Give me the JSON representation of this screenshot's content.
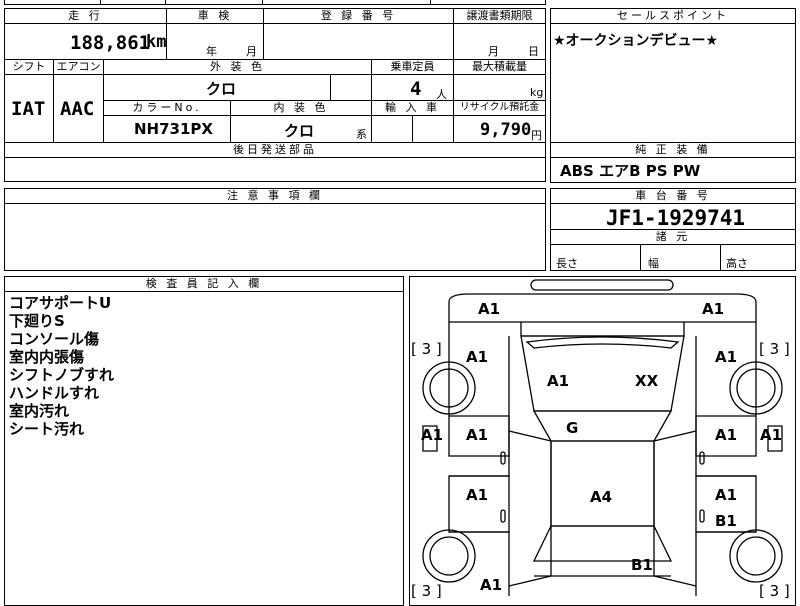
{
  "top_partial_text": "",
  "mileage": {
    "header": "走 行",
    "value": "188,861",
    "unit": "km"
  },
  "inspection": {
    "header": "車 検",
    "year_unit": "年",
    "month_unit": "月"
  },
  "registration": {
    "header": "登 録 番 号"
  },
  "transfer_deadline": {
    "header": "譲渡書類期限",
    "month_unit": "月",
    "day_unit": "日"
  },
  "sales_point": {
    "header": "セールスポイント",
    "text": "★オークションデビュー★"
  },
  "shift": {
    "header": "シフト",
    "value": "IAT"
  },
  "aircon": {
    "header": "エアコン",
    "value": "AAC"
  },
  "exterior_color": {
    "header": "外 装 色",
    "value": "クロ"
  },
  "capacity": {
    "header": "乗車定員",
    "value": "4",
    "unit": "人"
  },
  "max_load": {
    "header": "最大積載量",
    "unit": "kg"
  },
  "color_no": {
    "header": "カラーNo.",
    "value": "NH731PX"
  },
  "interior_color": {
    "header": "内 装 色",
    "value": "クロ",
    "suffix": "系"
  },
  "import_car": {
    "header": "輸 入 車"
  },
  "recycle": {
    "header": "リサイクル預託金",
    "value": "9,790",
    "unit": "円"
  },
  "later_parts": {
    "header": "後日発送部品"
  },
  "equipment": {
    "header": "純 正 装 備",
    "value": "ABS エアB PS PW"
  },
  "caution": {
    "header": "注 意 事 項 欄"
  },
  "chassis": {
    "header": "車 台 番 号",
    "value": "JF1-1929741"
  },
  "dimensions": {
    "header": "諸 元",
    "length": "長さ",
    "width": "幅",
    "height": "高さ"
  },
  "inspector": {
    "header": "検 査 員 記 入 欄",
    "notes": [
      "コアサポートU",
      "下廻りS",
      "コンソール傷",
      "室内内張傷",
      "シフトノブすれ",
      "ハンドルすれ",
      "室内汚れ",
      "シート汚れ"
    ]
  },
  "diagram": {
    "labels": {
      "a1_tl": "A1",
      "a1_tr": "A1",
      "t3_l": "[ 3 ]",
      "t3_r": "[ 3 ]",
      "a1_fl": "A1",
      "a1_fr": "A1",
      "a1_hood": "A1",
      "xx_hood": "XX",
      "g_glass": "G",
      "a1_sidel": "A1",
      "a1_sider": "A1",
      "a1_dl1": "A1",
      "a1_dr1": "A1",
      "a1_dl2": "A1",
      "a1_dr2": "A1",
      "b1_dr2": "B1",
      "a4_roof": "A4",
      "b1_rear": "B1",
      "a1_bl": "A1",
      "b3_l": "[ 3 ]",
      "b3_r": "[ 3 ]"
    }
  }
}
